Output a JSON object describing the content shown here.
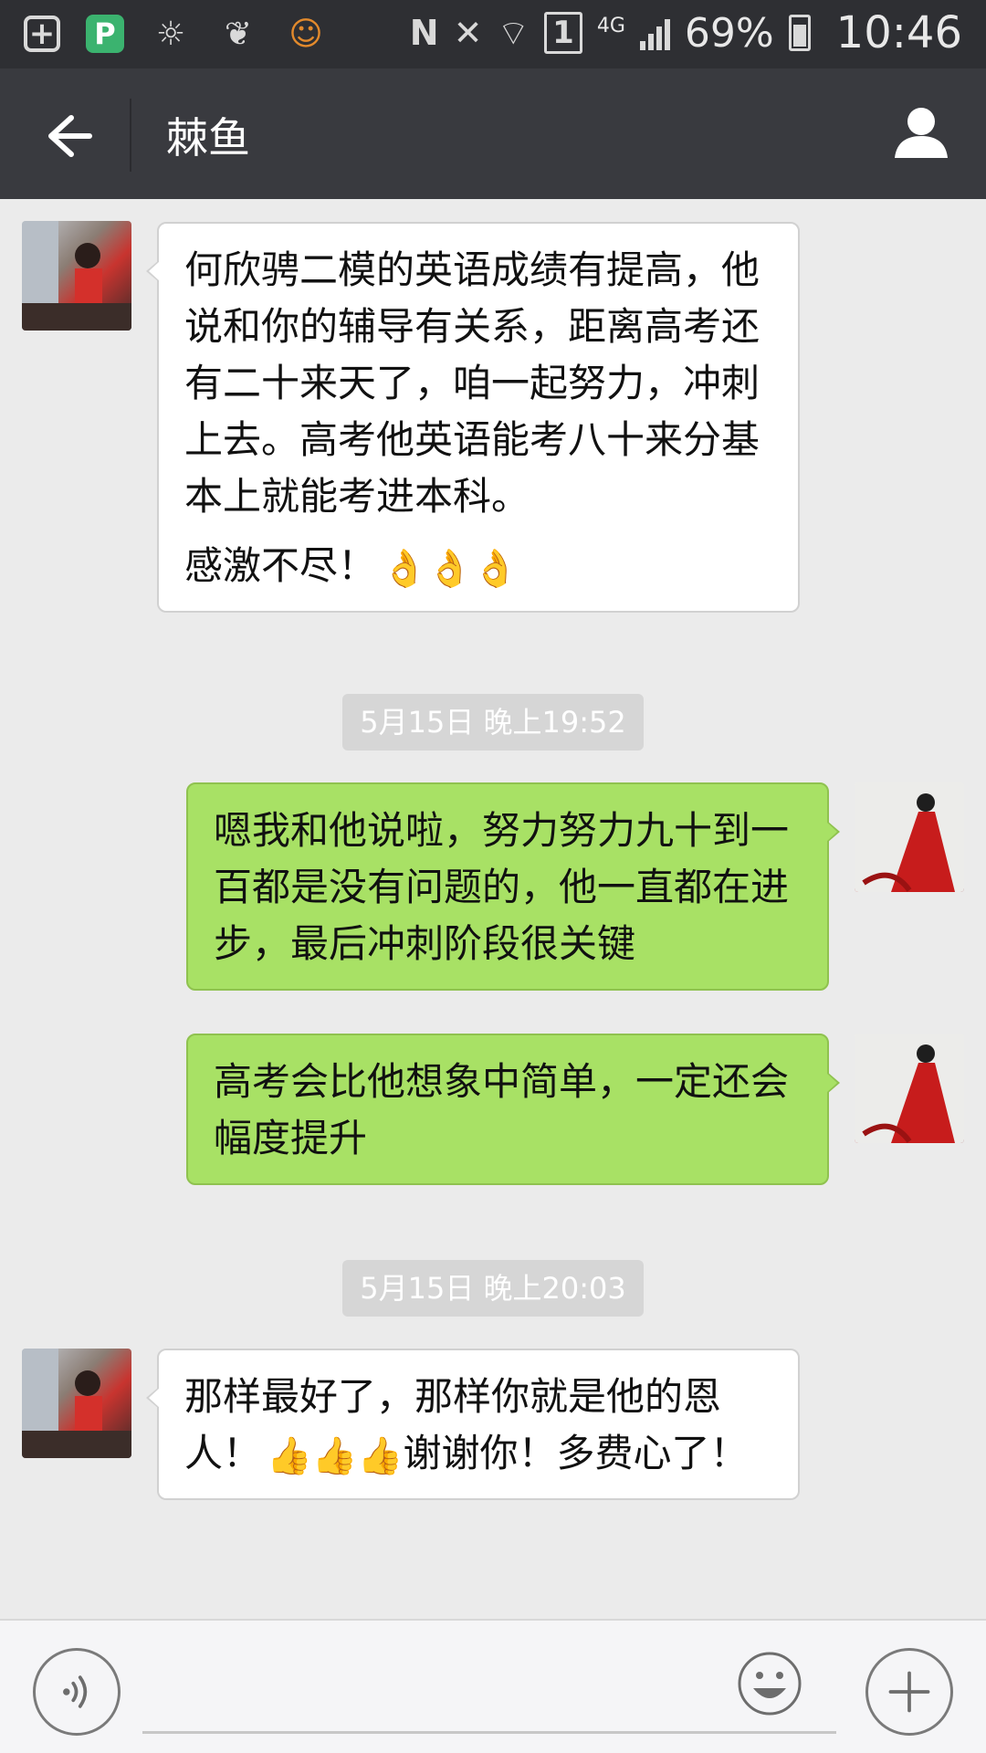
{
  "status_bar": {
    "network": "4G",
    "sim": "1",
    "battery_percent": "69%",
    "time": "10:46"
  },
  "header": {
    "title": "棘鱼"
  },
  "messages": [
    {
      "direction": "in",
      "paragraphs": [
        "何欣骋二模的英语成绩有提高，他说和你的辅导有关系，距离高考还有二十来天了，咱一起努力，冲刺上去。高考他英语能考八十来分基本上就能考进本科。",
        "感激不尽！"
      ],
      "emojis": "👌👌👌"
    },
    {
      "timestamp": "5月15日 晚上19:52"
    },
    {
      "direction": "out",
      "text": "嗯我和他说啦，努力努力九十到一百都是没有问题的，他一直都在进步，最后冲刺阶段很关键"
    },
    {
      "direction": "out",
      "text": "高考会比他想象中简单，一定还会幅度提升"
    },
    {
      "timestamp": "5月15日 晚上20:03"
    },
    {
      "direction": "in",
      "text_a": "那样最好了，那样你就是他的恩人！",
      "emojis": "👍👍👍",
      "text_b": "谢谢你！多费心了！"
    }
  ],
  "input": {
    "placeholder": ""
  },
  "icons": {
    "back": "arrow-left-icon",
    "profile": "person-icon",
    "voice": "voice-icon",
    "emoji": "smiley-icon",
    "plus": "plus-icon"
  },
  "colors": {
    "header_bg": "#393a3f",
    "status_bg": "#2e2f33",
    "chat_bg": "#ebebeb",
    "out_bubble": "#a8e165",
    "in_bubble": "#ffffff"
  }
}
